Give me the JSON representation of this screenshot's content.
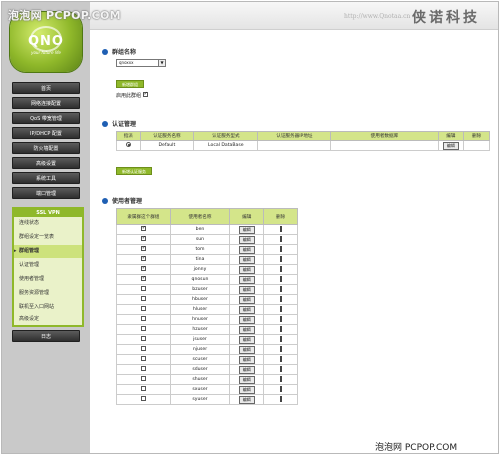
{
  "watermark_top": "泡泡网 PCPOP.COM",
  "watermark_bottom": "泡泡网 PCPOP.COM",
  "banner": {
    "url": "http://www.Qnotaa.cn",
    "brand": "侠诺科技"
  },
  "logo": {
    "text": "QNO",
    "tagline": "your future life"
  },
  "menu": [
    "首页",
    "网络连接配置",
    "QoS 带宽管理",
    "IP/DHCP 配置",
    "防火墙配置",
    "高级设置",
    "系统工具",
    "端口管理"
  ],
  "vpn": {
    "header": "SSL VPN",
    "items": [
      "连线状态",
      "群组设定一览表",
      "群组管理",
      "认证管理",
      "使用者管理",
      "服务资源管理",
      "联机至入口网站",
      "高级设定"
    ],
    "active_index": 2
  },
  "log_button": "日志",
  "group_section": {
    "title": "群组名称",
    "select_value": "qnoxxx",
    "add_button": "新增群组",
    "enable_label": "启用此群组"
  },
  "auth_section": {
    "title": "认证管理",
    "headers": [
      "指派",
      "认证服务名称",
      "认证服务型式",
      "认证服务器IP地址",
      "使用者数据库",
      "编辑",
      "删除"
    ],
    "rows": [
      {
        "name": "Default",
        "type": "Local DataBase",
        "ip": "",
        "db": "",
        "edit": "编辑"
      }
    ],
    "add_button": "新增认证服务"
  },
  "user_section": {
    "title": "使用者管理",
    "headers": [
      "隶属群这个群组",
      "使用者名称",
      "编辑",
      "删除"
    ],
    "edit_label": "编辑",
    "users": [
      {
        "name": "ben",
        "checked": true
      },
      {
        "name": "sun",
        "checked": true
      },
      {
        "name": "tom",
        "checked": true
      },
      {
        "name": "tina",
        "checked": true
      },
      {
        "name": "jonny",
        "checked": true
      },
      {
        "name": "qnosun",
        "checked": true
      },
      {
        "name": "bzuser",
        "checked": false
      },
      {
        "name": "hbuser",
        "checked": false
      },
      {
        "name": "hluser",
        "checked": false
      },
      {
        "name": "hnuser",
        "checked": false
      },
      {
        "name": "hzuser",
        "checked": false
      },
      {
        "name": "jsuser",
        "checked": false
      },
      {
        "name": "njuser",
        "checked": false
      },
      {
        "name": "scuser",
        "checked": false
      },
      {
        "name": "sduser",
        "checked": false
      },
      {
        "name": "shuser",
        "checked": false
      },
      {
        "name": "sxuser",
        "checked": false
      },
      {
        "name": "syuser",
        "checked": false
      }
    ]
  }
}
